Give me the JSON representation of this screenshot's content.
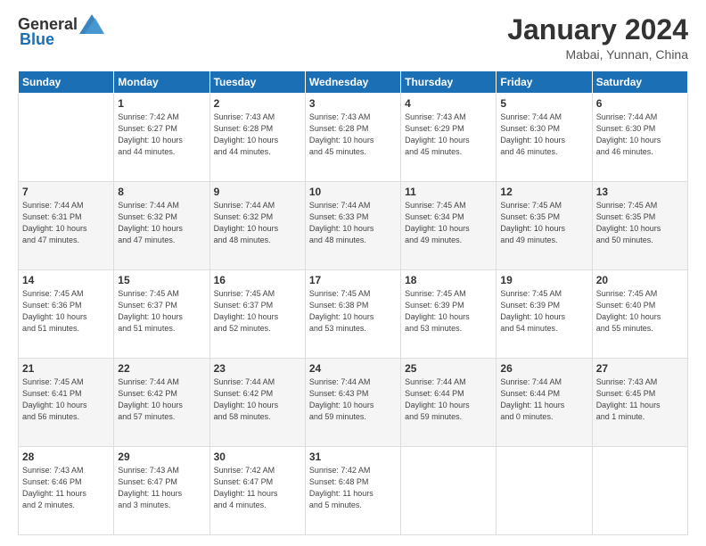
{
  "header": {
    "logo_general": "General",
    "logo_blue": "Blue",
    "month": "January 2024",
    "location": "Mabai, Yunnan, China"
  },
  "weekdays": [
    "Sunday",
    "Monday",
    "Tuesday",
    "Wednesday",
    "Thursday",
    "Friday",
    "Saturday"
  ],
  "weeks": [
    [
      {
        "day": "",
        "info": ""
      },
      {
        "day": "1",
        "info": "Sunrise: 7:42 AM\nSunset: 6:27 PM\nDaylight: 10 hours\nand 44 minutes."
      },
      {
        "day": "2",
        "info": "Sunrise: 7:43 AM\nSunset: 6:28 PM\nDaylight: 10 hours\nand 44 minutes."
      },
      {
        "day": "3",
        "info": "Sunrise: 7:43 AM\nSunset: 6:28 PM\nDaylight: 10 hours\nand 45 minutes."
      },
      {
        "day": "4",
        "info": "Sunrise: 7:43 AM\nSunset: 6:29 PM\nDaylight: 10 hours\nand 45 minutes."
      },
      {
        "day": "5",
        "info": "Sunrise: 7:44 AM\nSunset: 6:30 PM\nDaylight: 10 hours\nand 46 minutes."
      },
      {
        "day": "6",
        "info": "Sunrise: 7:44 AM\nSunset: 6:30 PM\nDaylight: 10 hours\nand 46 minutes."
      }
    ],
    [
      {
        "day": "7",
        "info": "Sunrise: 7:44 AM\nSunset: 6:31 PM\nDaylight: 10 hours\nand 47 minutes."
      },
      {
        "day": "8",
        "info": "Sunrise: 7:44 AM\nSunset: 6:32 PM\nDaylight: 10 hours\nand 47 minutes."
      },
      {
        "day": "9",
        "info": "Sunrise: 7:44 AM\nSunset: 6:32 PM\nDaylight: 10 hours\nand 48 minutes."
      },
      {
        "day": "10",
        "info": "Sunrise: 7:44 AM\nSunset: 6:33 PM\nDaylight: 10 hours\nand 48 minutes."
      },
      {
        "day": "11",
        "info": "Sunrise: 7:45 AM\nSunset: 6:34 PM\nDaylight: 10 hours\nand 49 minutes."
      },
      {
        "day": "12",
        "info": "Sunrise: 7:45 AM\nSunset: 6:35 PM\nDaylight: 10 hours\nand 49 minutes."
      },
      {
        "day": "13",
        "info": "Sunrise: 7:45 AM\nSunset: 6:35 PM\nDaylight: 10 hours\nand 50 minutes."
      }
    ],
    [
      {
        "day": "14",
        "info": "Sunrise: 7:45 AM\nSunset: 6:36 PM\nDaylight: 10 hours\nand 51 minutes."
      },
      {
        "day": "15",
        "info": "Sunrise: 7:45 AM\nSunset: 6:37 PM\nDaylight: 10 hours\nand 51 minutes."
      },
      {
        "day": "16",
        "info": "Sunrise: 7:45 AM\nSunset: 6:37 PM\nDaylight: 10 hours\nand 52 minutes."
      },
      {
        "day": "17",
        "info": "Sunrise: 7:45 AM\nSunset: 6:38 PM\nDaylight: 10 hours\nand 53 minutes."
      },
      {
        "day": "18",
        "info": "Sunrise: 7:45 AM\nSunset: 6:39 PM\nDaylight: 10 hours\nand 53 minutes."
      },
      {
        "day": "19",
        "info": "Sunrise: 7:45 AM\nSunset: 6:39 PM\nDaylight: 10 hours\nand 54 minutes."
      },
      {
        "day": "20",
        "info": "Sunrise: 7:45 AM\nSunset: 6:40 PM\nDaylight: 10 hours\nand 55 minutes."
      }
    ],
    [
      {
        "day": "21",
        "info": "Sunrise: 7:45 AM\nSunset: 6:41 PM\nDaylight: 10 hours\nand 56 minutes."
      },
      {
        "day": "22",
        "info": "Sunrise: 7:44 AM\nSunset: 6:42 PM\nDaylight: 10 hours\nand 57 minutes."
      },
      {
        "day": "23",
        "info": "Sunrise: 7:44 AM\nSunset: 6:42 PM\nDaylight: 10 hours\nand 58 minutes."
      },
      {
        "day": "24",
        "info": "Sunrise: 7:44 AM\nSunset: 6:43 PM\nDaylight: 10 hours\nand 59 minutes."
      },
      {
        "day": "25",
        "info": "Sunrise: 7:44 AM\nSunset: 6:44 PM\nDaylight: 10 hours\nand 59 minutes."
      },
      {
        "day": "26",
        "info": "Sunrise: 7:44 AM\nSunset: 6:44 PM\nDaylight: 11 hours\nand 0 minutes."
      },
      {
        "day": "27",
        "info": "Sunrise: 7:43 AM\nSunset: 6:45 PM\nDaylight: 11 hours\nand 1 minute."
      }
    ],
    [
      {
        "day": "28",
        "info": "Sunrise: 7:43 AM\nSunset: 6:46 PM\nDaylight: 11 hours\nand 2 minutes."
      },
      {
        "day": "29",
        "info": "Sunrise: 7:43 AM\nSunset: 6:47 PM\nDaylight: 11 hours\nand 3 minutes."
      },
      {
        "day": "30",
        "info": "Sunrise: 7:42 AM\nSunset: 6:47 PM\nDaylight: 11 hours\nand 4 minutes."
      },
      {
        "day": "31",
        "info": "Sunrise: 7:42 AM\nSunset: 6:48 PM\nDaylight: 11 hours\nand 5 minutes."
      },
      {
        "day": "",
        "info": ""
      },
      {
        "day": "",
        "info": ""
      },
      {
        "day": "",
        "info": ""
      }
    ]
  ]
}
